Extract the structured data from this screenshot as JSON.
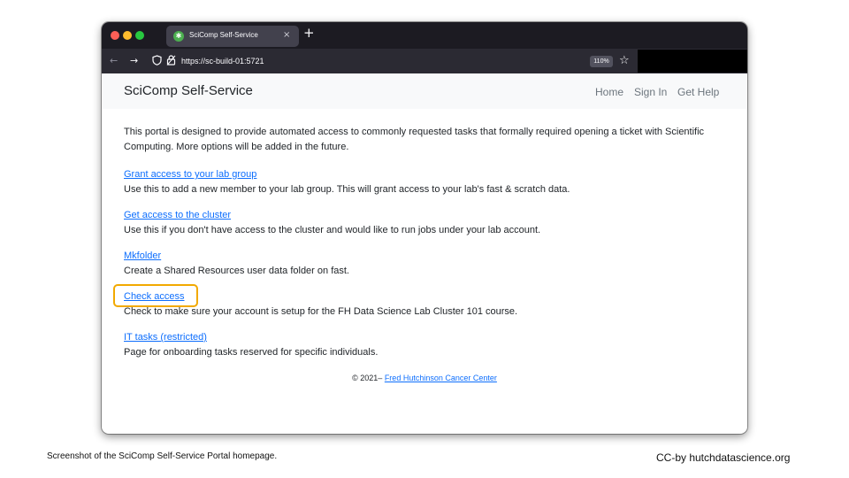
{
  "browser": {
    "tab_title": "SciComp Self-Service",
    "tab_close": "×",
    "new_tab": "+",
    "url": "https://sc-build-01:5721",
    "zoom": "110%",
    "colors": {
      "close": "#fe5f57",
      "minimize": "#febc2e",
      "maximize": "#28c840"
    },
    "icons": [
      "back-arrow-icon",
      "forward-arrow-icon",
      "shield-icon",
      "lock-icon",
      "star-icon"
    ]
  },
  "header": {
    "brand": "SciComp Self-Service",
    "nav": {
      "home": "Home",
      "sign_in": "Sign In",
      "help": "Get Help"
    }
  },
  "intro": "This portal is designed to provide automated access to commonly requested tasks that formally required opening a ticket with Scientific Computing. More options will be added in the future.",
  "items": [
    {
      "link": "Grant access to your lab group",
      "desc": "Use this to add a new member to your lab group. This will grant access to your lab's fast & scratch data."
    },
    {
      "link": "Get access to the cluster",
      "desc": "Use this if you don't have access to the cluster and would like to run jobs under your lab account."
    },
    {
      "link": "Mkfolder",
      "desc": "Create a Shared Resources user data folder on fast."
    },
    {
      "link": "Check access",
      "desc": "Check to make sure your account is setup for the FH Data Science Lab Cluster 101 course."
    },
    {
      "link": "IT tasks (restricted)",
      "desc": "Page for onboarding tasks reserved for specific individuals."
    }
  ],
  "footer": {
    "prefix": "© 2021–",
    "link": "Fred Hutchinson Cancer Center"
  },
  "highlight_color": "#f2a900",
  "caption": {
    "left": "Screenshot of the SciComp Self-Service Portal homepage.",
    "right": "CC-by hutchdatascience.org"
  }
}
